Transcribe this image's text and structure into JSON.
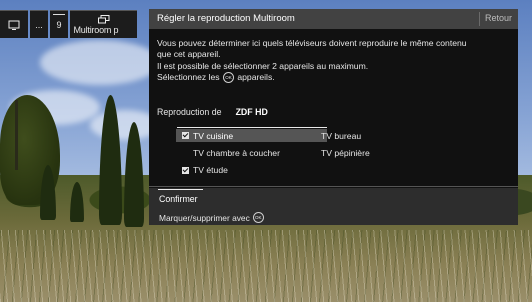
{
  "channel_bar": {
    "dots_label": "...",
    "number_label": "9",
    "multiroom_label": "Multiroom p"
  },
  "dialog": {
    "title": "Régler la reproduction Multiroom",
    "back_label": "Retour",
    "info_lines": [
      "Vous pouvez déterminer ici quels téléviseurs doivent reproduire le même contenu",
      "que cet appareil.",
      "Il est possible de sélectionner 2 appareils au maximum.",
      "Sélectionnez les",
      "appareils."
    ],
    "ok_badge": "OK",
    "reproduction_label": "Reproduction de",
    "reproduction_value": "ZDF HD",
    "devices": [
      {
        "label": "TV cuisine",
        "checked": true,
        "selected": true
      },
      {
        "label": "TV bureau",
        "checked": false,
        "selected": false
      },
      {
        "label": "TV chambre à coucher",
        "checked": false,
        "selected": false
      },
      {
        "label": "TV pépinière",
        "checked": false,
        "selected": false
      },
      {
        "label": "TV étude",
        "checked": true,
        "selected": false
      }
    ],
    "confirm_label": "Confirmer",
    "hint_label": "Marquer/supprimer avec"
  }
}
